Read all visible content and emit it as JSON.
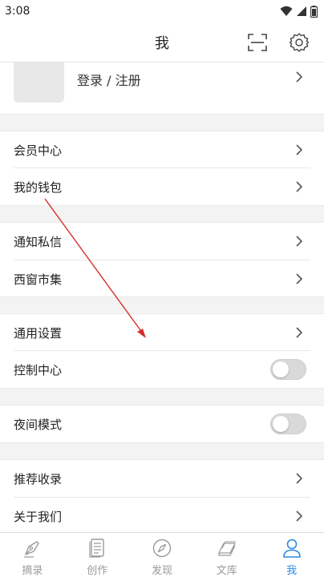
{
  "status": {
    "time": "3:08"
  },
  "header": {
    "title": "我"
  },
  "profile": {
    "label": "登录 / 注册"
  },
  "menu": {
    "member_center": "会员中心",
    "wallet": "我的钱包",
    "notifications": "通知私信",
    "xichuang_market": "西窗市集",
    "general_settings": "通用设置",
    "control_center": "控制中心",
    "night_mode": "夜间模式",
    "recommend": "推荐收录",
    "about": "关于我们"
  },
  "toggles": {
    "control_center_on": false,
    "night_mode_on": false
  },
  "tabs": [
    {
      "label": "摘录",
      "icon": "pen-nib-icon"
    },
    {
      "label": "创作",
      "icon": "document-icon"
    },
    {
      "label": "发现",
      "icon": "compass-icon"
    },
    {
      "label": "文库",
      "icon": "books-icon"
    },
    {
      "label": "我",
      "icon": "person-icon"
    }
  ],
  "colors": {
    "accent": "#2b8be0",
    "annotation_arrow": "#d32f2f"
  }
}
